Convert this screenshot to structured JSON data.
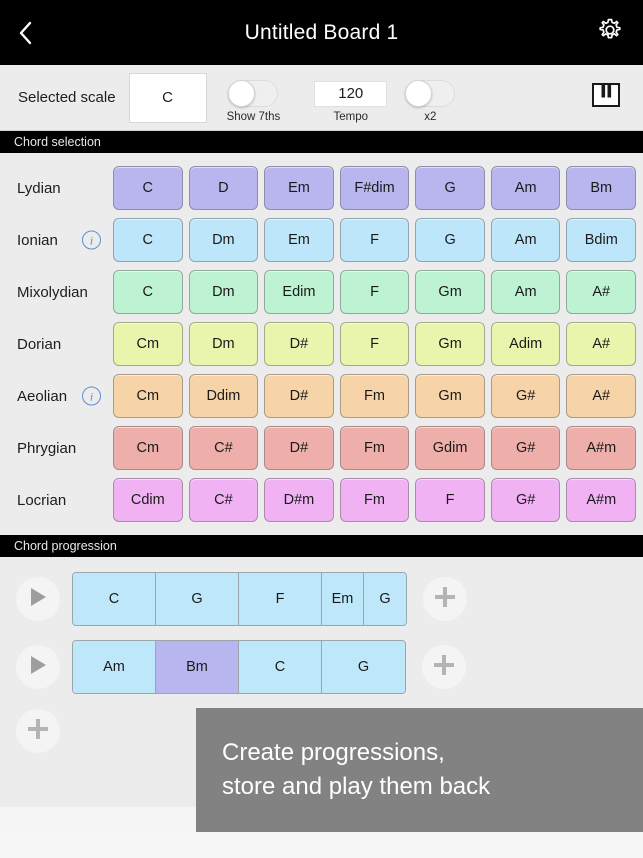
{
  "nav": {
    "back_icon": "chevron-left-icon",
    "title": "Untitled Board 1",
    "gear_icon": "gear-icon"
  },
  "toolbar": {
    "scale_label": "Selected scale",
    "scale_value": "C",
    "show_sevenths": {
      "caption": "Show 7ths",
      "on": false
    },
    "tempo": {
      "value": "120",
      "caption": "Tempo"
    },
    "x2": {
      "caption": "x2",
      "on": false
    },
    "piano_icon": "piano-keys-icon"
  },
  "chord_selection": {
    "section_title": "Chord selection",
    "rows": [
      {
        "mode": "Lydian",
        "info": false,
        "color": "#b9b5ef",
        "chords": [
          "C",
          "D",
          "Em",
          "F#dim",
          "G",
          "Am",
          "Bm"
        ]
      },
      {
        "mode": "Ionian",
        "info": true,
        "color": "#bee6fa",
        "chords": [
          "C",
          "Dm",
          "Em",
          "F",
          "G",
          "Am",
          "Bdim"
        ]
      },
      {
        "mode": "Mixolydian",
        "info": false,
        "color": "#bdf3d2",
        "chords": [
          "C",
          "Dm",
          "Edim",
          "F",
          "Gm",
          "Am",
          "A#"
        ]
      },
      {
        "mode": "Dorian",
        "info": false,
        "color": "#e9f5ac",
        "chords": [
          "Cm",
          "Dm",
          "D#",
          "F",
          "Gm",
          "Adim",
          "A#"
        ]
      },
      {
        "mode": "Aeolian",
        "info": true,
        "color": "#f7d3a8",
        "chords": [
          "Cm",
          "Ddim",
          "D#",
          "Fm",
          "Gm",
          "G#",
          "A#"
        ]
      },
      {
        "mode": "Phrygian",
        "info": false,
        "color": "#eeafab",
        "chords": [
          "Cm",
          "C#",
          "D#",
          "Fm",
          "Gdim",
          "G#",
          "A#m"
        ]
      },
      {
        "mode": "Locrian",
        "info": false,
        "color": "#f1b2f4",
        "chords": [
          "Cdim",
          "C#",
          "D#m",
          "Fm",
          "F",
          "G#",
          "A#m"
        ]
      }
    ]
  },
  "chord_progression": {
    "section_title": "Chord progression",
    "play_icon": "play-icon",
    "add_icon": "plus-icon",
    "default_cell_color": "#bfe7fa",
    "selected_cell_color": "#b9b5ef",
    "progressions": [
      {
        "cells": [
          {
            "label": "C",
            "width": 83,
            "selected": false
          },
          {
            "label": "G",
            "width": 83,
            "selected": false
          },
          {
            "label": "F",
            "width": 83,
            "selected": false
          },
          {
            "label": "Em",
            "width": 42,
            "selected": false
          },
          {
            "label": "G",
            "width": 42,
            "selected": false
          }
        ]
      },
      {
        "cells": [
          {
            "label": "Am",
            "width": 83,
            "selected": false
          },
          {
            "label": "Bm",
            "width": 83,
            "selected": true
          },
          {
            "label": "C",
            "width": 83,
            "selected": false
          },
          {
            "label": "G",
            "width": 83,
            "selected": false
          }
        ]
      }
    ]
  },
  "overlay": {
    "line1": "Create progressions,",
    "line2": "store and play them back"
  }
}
